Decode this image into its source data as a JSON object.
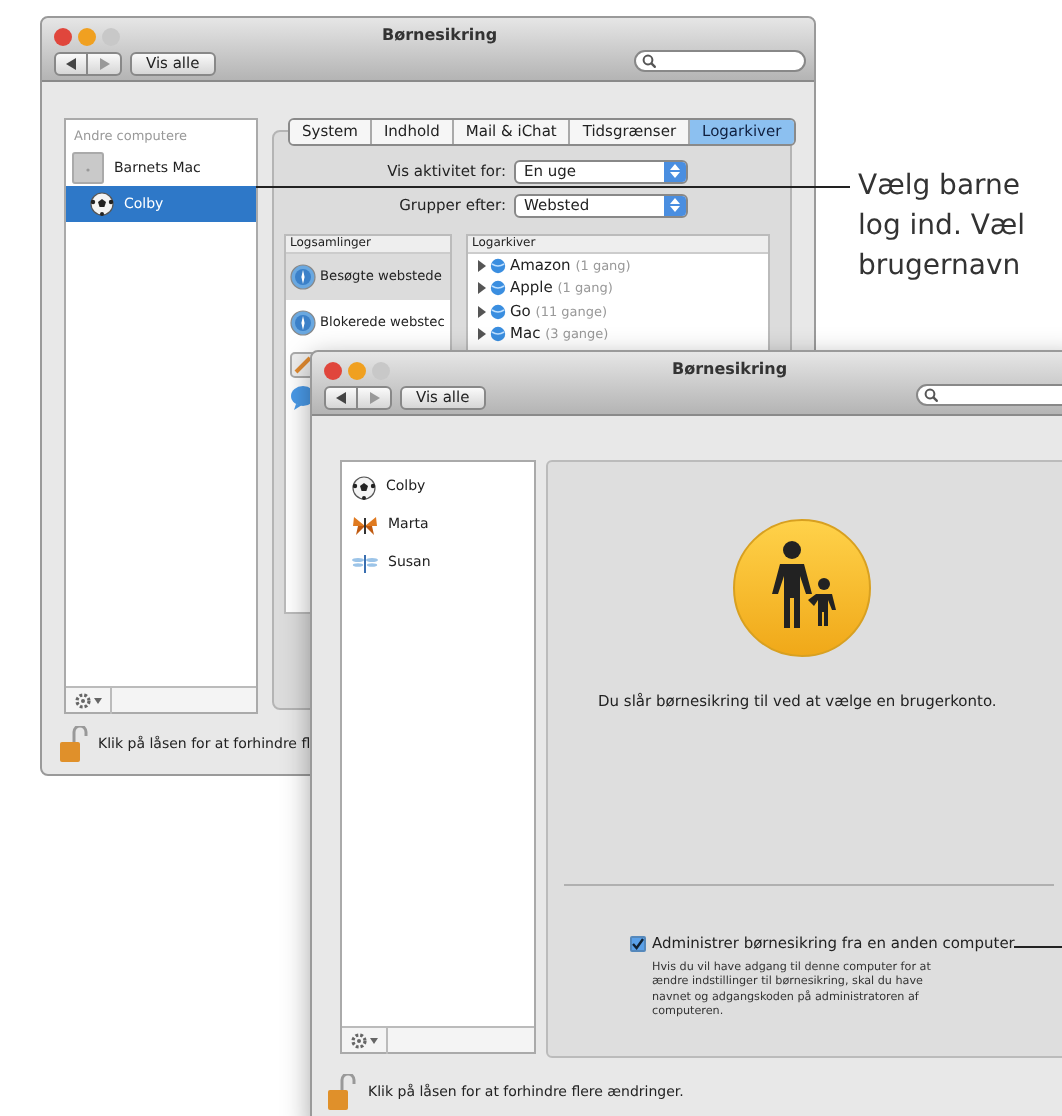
{
  "back_window": {
    "title": "Børnesikring",
    "nav_button": "Vis alle",
    "sidebar": {
      "section": "Andre computere",
      "items": [
        {
          "label": "Barnets Mac",
          "kind": "computer",
          "selected": false
        },
        {
          "label": "Colby",
          "kind": "ball",
          "selected": true
        }
      ]
    },
    "tabs": [
      {
        "label": "System",
        "selected": false
      },
      {
        "label": "Indhold",
        "selected": false
      },
      {
        "label": "Mail & iChat",
        "selected": false
      },
      {
        "label": "Tidsgrænser",
        "selected": false
      },
      {
        "label": "Logarkiver",
        "selected": true
      }
    ],
    "fields": [
      {
        "label": "Vis aktivitet for:",
        "value": "En uge"
      },
      {
        "label": "Grupper efter:",
        "value": "Websted"
      }
    ],
    "log_collections": {
      "header": "Logsamlinger",
      "items": [
        {
          "label": "Besøgte webstede",
          "selected": true
        },
        {
          "label": "Blokerede webstec",
          "selected": false
        }
      ]
    },
    "logs": {
      "header": "Logarkiver",
      "items": [
        {
          "name": "Amazon",
          "count": "(1 gang)"
        },
        {
          "name": "Apple",
          "count": "(1 gang)"
        },
        {
          "name": "Go",
          "count": "(11 gange)"
        },
        {
          "name": "Mac",
          "count": "(3 gange)"
        }
      ]
    },
    "lock_text": "Klik på låsen for at forhindre fl"
  },
  "front_window": {
    "title": "Børnesikring",
    "nav_button": "Vis alle",
    "users": [
      {
        "name": "Colby",
        "kind": "ball"
      },
      {
        "name": "Marta",
        "kind": "butterfly"
      },
      {
        "name": "Susan",
        "kind": "dragonfly"
      }
    ],
    "message": "Du slår børnesikring til ved at vælge en brugerkonto.",
    "remote_option": {
      "label": "Administrer børnesikring fra en anden computer",
      "checked": true,
      "description": "Hvis du vil have adgang til denne computer for at ændre indstillinger til børnesikring, skal du have navnet og adgangskoden på administratoren af computeren."
    },
    "lock_text": "Klik på låsen for at forhindre flere ændringer."
  },
  "callout": {
    "lines": [
      "Vælg barne",
      "log ind. Væl",
      "brugernavn"
    ]
  }
}
